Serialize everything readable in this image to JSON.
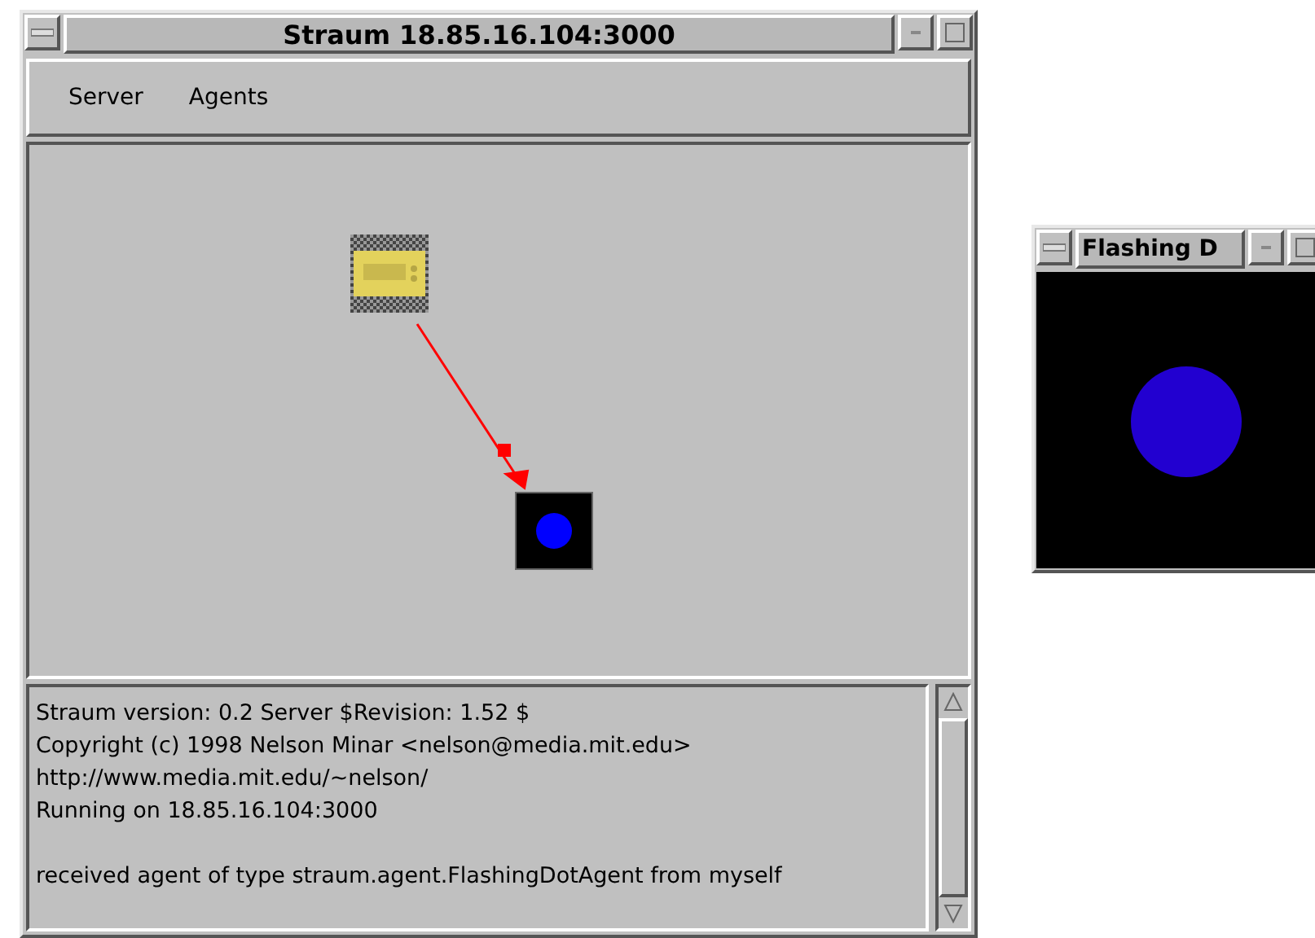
{
  "main_window": {
    "title": "Straum 18.85.16.104:3000"
  },
  "menu": [
    "Server",
    "Agents"
  ],
  "log_paragraphs": [
    [
      "Straum version: 0.2 Server $Revision: 1.52 $",
      "Copyright (c) 1998 Nelson Minar <nelson@media.mit.edu>",
      "http://www.media.mit.edu/~nelson/",
      "Running on 18.85.16.104:3000"
    ],
    [
      "received agent of type straum.agent.FlashingDotAgent from myself"
    ]
  ],
  "agent_window": {
    "title": "Flashing D"
  }
}
